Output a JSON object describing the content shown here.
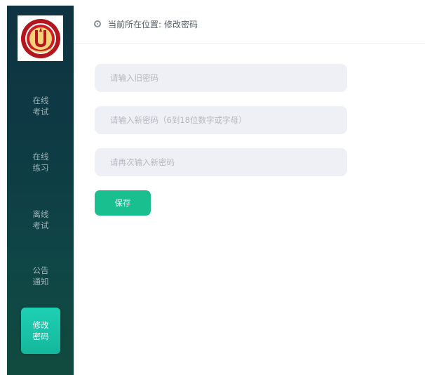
{
  "sidebar": {
    "logo_alt": "school-emblem",
    "items": [
      {
        "line1": "在线",
        "line2": "考试",
        "active": false
      },
      {
        "line1": "在线",
        "line2": "练习",
        "active": false
      },
      {
        "line1": "离线",
        "line2": "考试",
        "active": false
      },
      {
        "line1": "公告",
        "line2": "通知",
        "active": false
      },
      {
        "line1": "修改",
        "line2": "密码",
        "active": true
      }
    ]
  },
  "breadcrumb": {
    "icon": "target-icon",
    "prefix": "当前所在位置:",
    "current": "修改密码"
  },
  "form": {
    "old_password_placeholder": "请输入旧密码",
    "new_password_placeholder": "请输入新密码（6到18位数字或字母）",
    "confirm_password_placeholder": "请再次输入新密码",
    "save_label": "保存"
  },
  "colors": {
    "sidebar_top": "#0f3340",
    "sidebar_bottom": "#114a3e",
    "accent": "#19bf8f",
    "active_nav": "#1fd0b4",
    "field_bg": "#eff0f5"
  }
}
